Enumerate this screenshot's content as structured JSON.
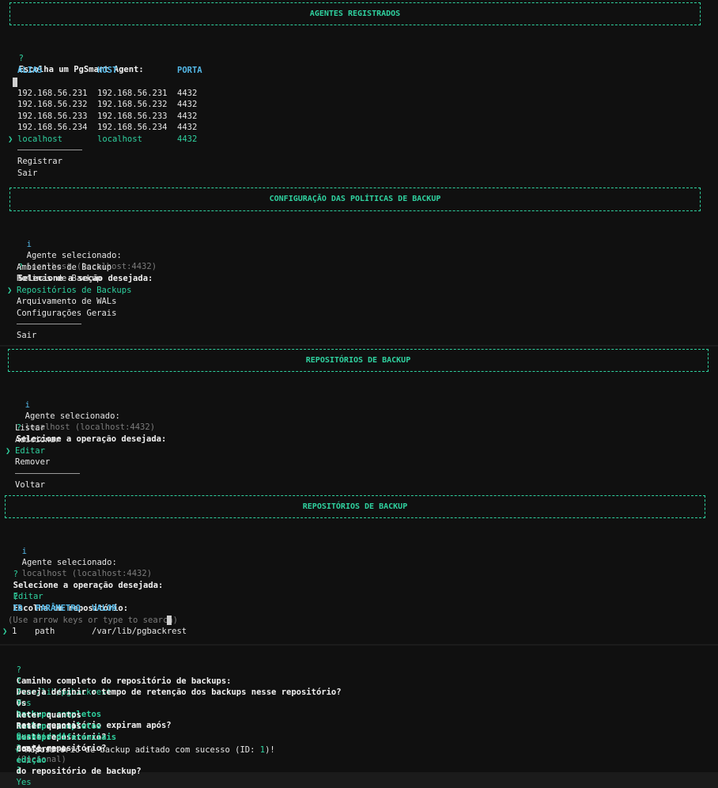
{
  "s1": {
    "title": "AGENTES REGISTRADOS",
    "q": "?",
    "prompt": "Escolha um PgSmart Agent:",
    "headers": [
      "ALIAS",
      "HOST",
      "PORTA"
    ],
    "rows": [
      [
        "192.168.56.231",
        "192.168.56.231",
        "4432"
      ],
      [
        "192.168.56.232",
        "192.168.56.232",
        "4432"
      ],
      [
        "192.168.56.233",
        "192.168.56.233",
        "4432"
      ],
      [
        "192.168.56.234",
        "192.168.56.234",
        "4432"
      ],
      [
        "localhost",
        "localhost",
        "4432"
      ]
    ],
    "pointer": "❯",
    "extra": [
      "Registrar",
      "Sair"
    ]
  },
  "s2": {
    "title": "CONFIGURAÇÃO DAS POLÍTICAS DE BACKUP",
    "info_icon": "i",
    "agent_label": "Agente selecionado:",
    "agent_value": "localhost (localhost:4432)",
    "prompt": "Selecione a seção desejada:",
    "items": [
      "Ambientes de Backup",
      "Rotinas de Backup",
      "Repositórios de Backups",
      "Arquivamento de WALs",
      "Configurações Gerais"
    ],
    "exit": "Sair"
  },
  "s3": {
    "title": "REPOSITÓRIOS DE BACKUP",
    "agent_label": "Agente selecionado:",
    "agent_value": "localhost (localhost:4432)",
    "prompt": "Selecione a operação desejada:",
    "items": [
      "Listar",
      "Adicionar",
      "Editar",
      "Remover"
    ],
    "back": "Voltar"
  },
  "s4": {
    "title": "REPOSITÓRIOS DE BACKUP",
    "agent_label": "Agente selecionado:",
    "agent_value": "localhost (localhost:4432)",
    "op_prompt": "Selecione a operação desejada:",
    "op_value": "Editar",
    "repo_prompt": "Escolha um repositório:",
    "headers": [
      "ID",
      "PARÂMETRO",
      "VALOR"
    ],
    "hint": "(Use arrow keys or type to search)",
    "row": [
      "1",
      "path",
      "/var/lib/pgbackrest"
    ]
  },
  "s5": {
    "l1_text": "Caminho completo do repositório de backups:",
    "l1_value": "/var/lib/pgbackrest",
    "l2_text": "Deseja definir o tempo de retenção dos backups nesse repositório?",
    "l2_value": "Yes",
    "l3_a": "Os",
    "l3_hl": "backups completos",
    "l3_b": "neste repositório expiram após?",
    "l3_value": "Quantidade",
    "l4_a": "Reter quantos",
    "l4_hl": "backups completos",
    "l4_b": "neste repositório?",
    "l4_value": "2",
    "l5_a": "Reter quantos",
    "l5_hl": "backups diferenciais",
    "l5_b": "neste repositório?",
    "l5_opt": "(Opcional)",
    "l5_value": "1",
    "c_a": "Confirma a",
    "c_hl": "edição",
    "c_b": "do repositório de backup?",
    "c_value": "Yes",
    "check": "√",
    "success_a": "Repositório de backup aditado com sucesso (ID:",
    "success_id": "1",
    "success_b": ")!"
  }
}
